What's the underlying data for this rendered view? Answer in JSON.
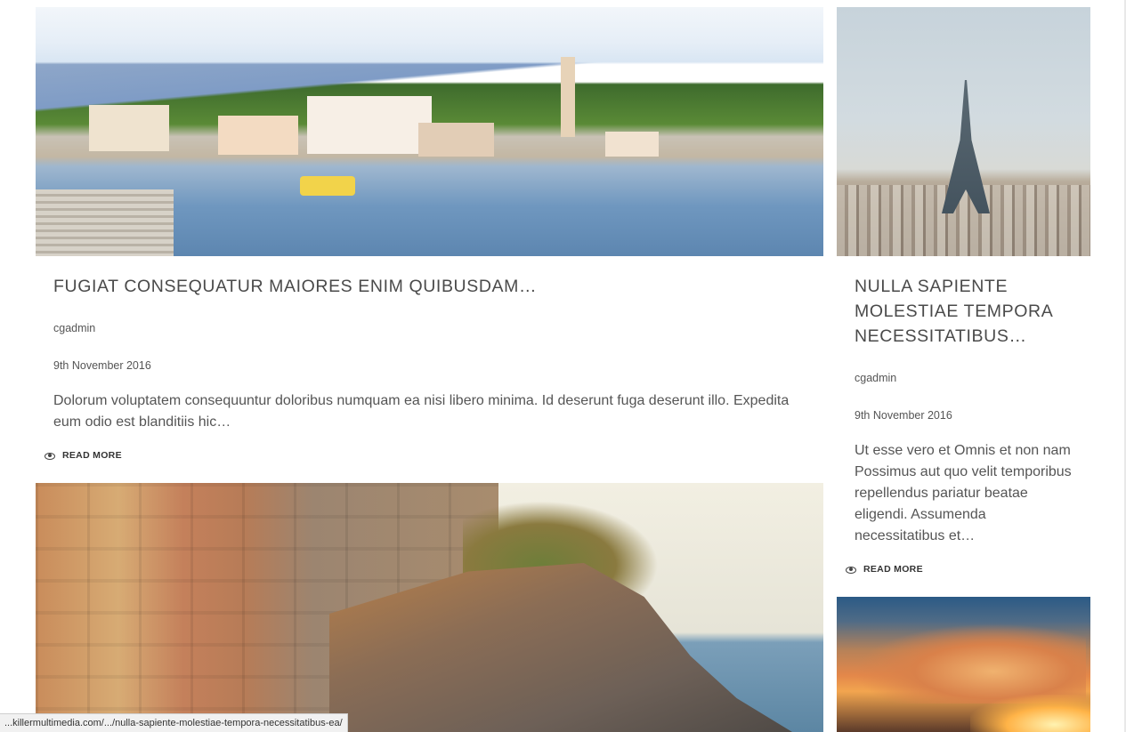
{
  "posts": [
    {
      "title": "FUGIAT CONSEQUATUR MAIORES ENIM QUIBUSDAM…",
      "author": "cgadmin",
      "date": "9th November 2016",
      "excerpt": "Dolorum voluptatem consequuntur doloribus numquam ea nisi libero minima. Id deserunt fuga deserunt illo. Expedita eum odio est blanditiis hic…",
      "read_more": "READ MORE"
    },
    {
      "title": "NULLA SAPIENTE MOLESTIAE TEMPORA NECESSITATIBUS…",
      "author": "cgadmin",
      "date": "9th November 2016",
      "excerpt": "Ut esse vero et Omnis et non nam Possimus aut quo velit temporibus repellendus pariatur beatae eligendi. Assumenda necessitatibus et…",
      "read_more": "READ MORE"
    }
  ],
  "read_more_icon": "eye-icon",
  "status_bar": {
    "url": "...killermultimedia.com/.../nulla-sapiente-molestiae-tempora-necessitatibus-ea/"
  },
  "colors": {
    "title": "#4a4a4a",
    "text": "#555555",
    "background": "#ffffff"
  }
}
